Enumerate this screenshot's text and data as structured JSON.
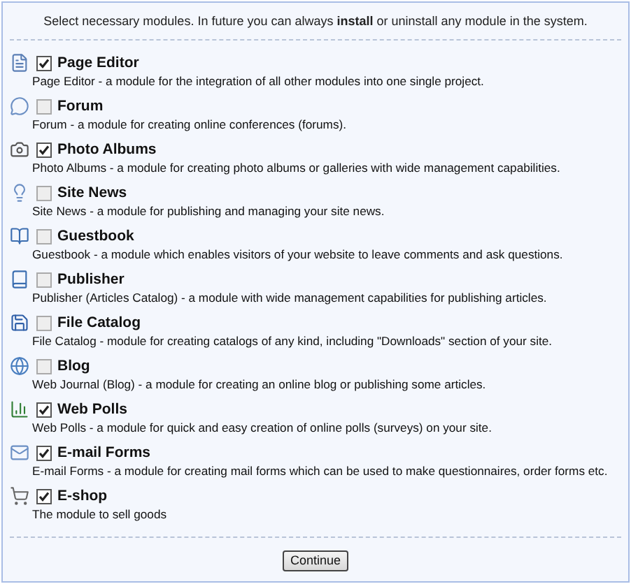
{
  "intro": "Select necessary modules. In future you can always **install** or uninstall any module in the system.",
  "modules": [
    {
      "title": "Page Editor",
      "checked": true,
      "description": "Page Editor - a module for the integration of all other modules into one single project."
    },
    {
      "title": "Forum",
      "checked": false,
      "description": "Forum - a module for creating online conferences (forums)."
    },
    {
      "title": "Photo Albums",
      "checked": true,
      "description": "Photo Albums - a module for creating photo albums or galleries with wide management capabilities."
    },
    {
      "title": "Site News",
      "checked": false,
      "description": "Site News - a module for publishing and managing your site news."
    },
    {
      "title": "Guestbook",
      "checked": false,
      "description": "Guestbook - a module which enables visitors of your website to leave comments and ask questions."
    },
    {
      "title": "Publisher",
      "checked": false,
      "description": "Publisher (Articles Catalog) - a module with wide management capabilities for publishing articles."
    },
    {
      "title": "File Catalog",
      "checked": false,
      "description": "File Catalog - module for creating catalogs of any kind, including \"Downloads\" section of your site."
    },
    {
      "title": "Blog",
      "checked": false,
      "description": "Web Journal (Blog) - a module for creating an online blog or publishing some articles."
    },
    {
      "title": "Web Polls",
      "checked": true,
      "description": "Web Polls - a module for quick and easy creation of online polls (surveys) on your site."
    },
    {
      "title": "E-mail Forms",
      "checked": true,
      "description": "E-mail Forms - a module for creating mail forms which can be used to make questionnaires, order forms etc."
    },
    {
      "title": "E-shop",
      "checked": true,
      "description": "The module to sell goods"
    }
  ],
  "button": "Continue"
}
